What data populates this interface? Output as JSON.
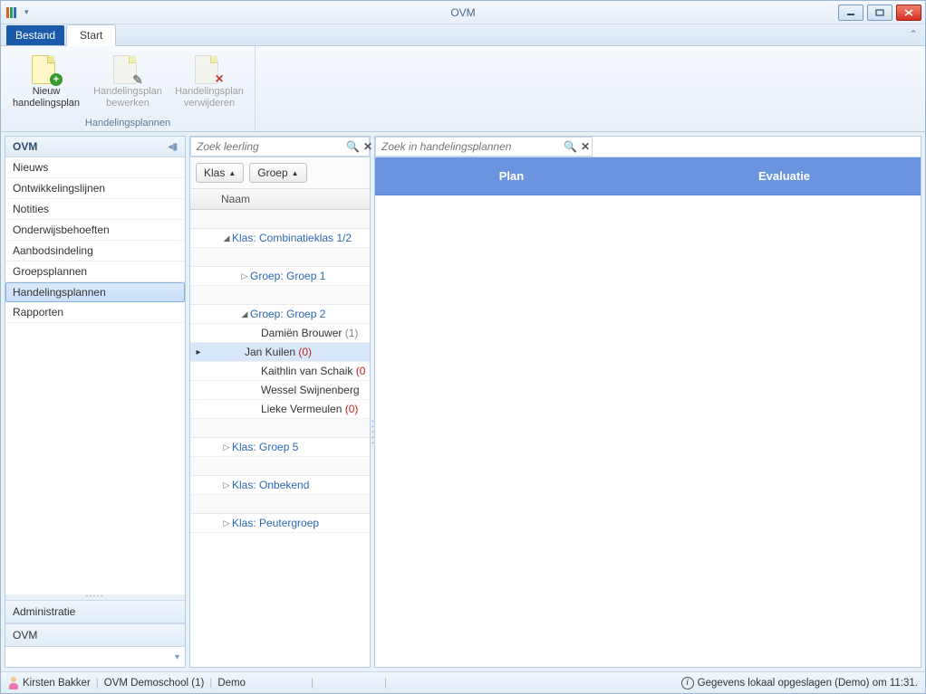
{
  "window": {
    "title": "OVM"
  },
  "ribbon": {
    "file_tab": "Bestand",
    "start_tab": "Start",
    "group_label": "Handelingsplannen",
    "buttons": {
      "new": "Nieuw handelingsplan",
      "edit": "Handelingsplan bewerken",
      "delete": "Handelingsplan verwijderen"
    }
  },
  "sidebar": {
    "header": "OVM",
    "items": [
      "Nieuws",
      "Ontwikkelingslijnen",
      "Notities",
      "Onderwijsbehoeften",
      "Aanbodsindeling",
      "Groepsplannen",
      "Handelingsplannen",
      "Rapporten"
    ],
    "section_admin": "Administratie",
    "section_ovm": "OVM"
  },
  "center": {
    "search_placeholder": "Zoek leerling",
    "groupby": {
      "klas": "Klas",
      "groep": "Groep"
    },
    "column_header": "Naam",
    "tree": {
      "klas1": "Klas: Combinatieklas 1/2",
      "groep1": "Groep: Groep 1",
      "groep2": "Groep: Groep 2",
      "students": [
        {
          "name": "Damiën Brouwer",
          "count": "(1)",
          "red": false
        },
        {
          "name": "Jan Kuilen",
          "count": "(0)",
          "red": true
        },
        {
          "name": "Kaithlin van Schaik",
          "count": "(0",
          "red": true
        },
        {
          "name": "Wessel Swijnenberg",
          "count": "",
          "red": false
        },
        {
          "name": "Lieke Vermeulen",
          "count": "(0)",
          "red": true
        }
      ],
      "klas5": "Klas: Groep 5",
      "klas_onb": "Klas: Onbekend",
      "klas_peuter": "Klas: Peutergroep"
    }
  },
  "detail": {
    "search_placeholder": "Zoek in handelingsplannen",
    "col_plan": "Plan",
    "col_eval": "Evaluatie"
  },
  "status": {
    "user": "Kirsten Bakker",
    "school": "OVM Demoschool (1)",
    "env": "Demo",
    "saved": "Gegevens lokaal opgeslagen (Demo) om 11:31."
  }
}
